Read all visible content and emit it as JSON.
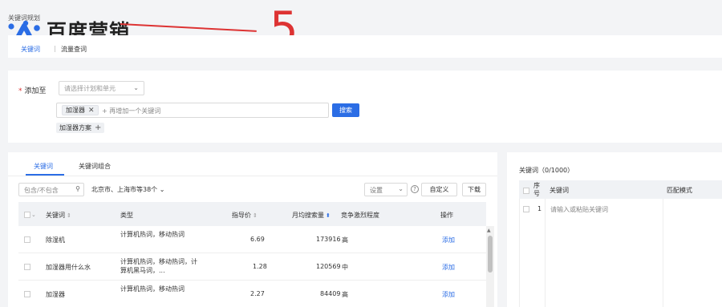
{
  "breadcrumb": "关键词规划",
  "logo": {
    "text": "百度营销"
  },
  "annotation": {
    "number": "5",
    "color": "#d33333"
  },
  "colors": {
    "accent": "#2b6de5",
    "background": "#f3f4f6"
  },
  "top_tabs": [
    {
      "label": "关键词",
      "active": true
    },
    {
      "label": "流量查词",
      "active": false
    }
  ],
  "add_to": {
    "label": "添加至",
    "select_placeholder": "请选择计划和单元",
    "keyword_chip": "加湿器",
    "keyword_placeholder": "+ 再增加一个关键词",
    "search_button": "搜索",
    "plan_chip": "加湿器方案"
  },
  "left_panel": {
    "tabs": [
      {
        "label": "关键词",
        "active": true
      },
      {
        "label": "关键词组合",
        "active": false
      }
    ],
    "filter_placeholder": "包含/不包含",
    "region": "北京市、上海市等38个",
    "settings_label": "设置",
    "help": "?",
    "custom_button": "自定义",
    "download_button": "下载",
    "columns": {
      "keyword": "关键词",
      "type": "类型",
      "price": "指导价",
      "volume": "月均搜索量",
      "competition": "竞争激烈程度",
      "action": "操作"
    },
    "rows": [
      {
        "keyword": "除湿机",
        "type": "计算机热词，移动热词",
        "price": "6.69",
        "volume": "173916",
        "competition": "高",
        "action": "添加"
      },
      {
        "keyword": "加湿器用什么水",
        "type": "计算机热词，移动热词，计算机黑马词，...",
        "price": "1.28",
        "volume": "120569",
        "competition": "中",
        "action": "添加"
      },
      {
        "keyword": "加湿器",
        "type": "计算机热词，移动热词",
        "price": "2.27",
        "volume": "84409",
        "competition": "高",
        "action": "添加"
      }
    ]
  },
  "right_panel": {
    "title": "关键词（0/1000）",
    "columns": {
      "index": "序号",
      "keyword": "关键词",
      "match": "匹配模式"
    },
    "first_row_index": "1",
    "input_placeholder": "请输入或粘贴关键词"
  }
}
